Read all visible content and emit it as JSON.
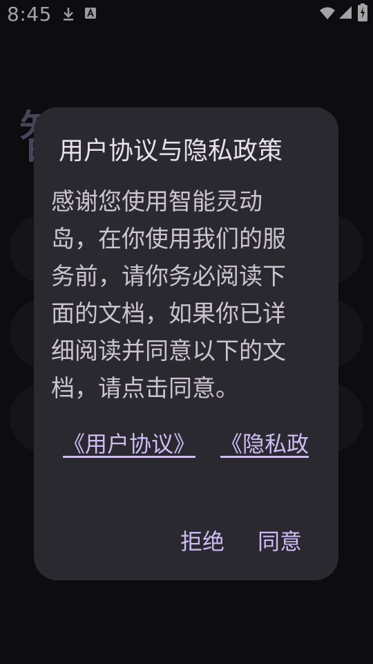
{
  "status_bar": {
    "time": "8:45",
    "icons": [
      "download-icon",
      "text-a-icon",
      "wifi-icon",
      "signal-icon",
      "battery-charging-icon"
    ]
  },
  "background": {
    "title_fragment": "智能灵动",
    "card_glyphs": [
      "·",
      "·",
      "·"
    ]
  },
  "dialog": {
    "title": "用户协议与隐私政策",
    "body": "感谢您使用智能灵动岛，在你使用我们的服务前，请你务必阅读下面的文档，如果你已详细阅读并同意以下的文档，请点击同意。",
    "links": {
      "user_agreement": "《用户协议》",
      "privacy_policy": "《隐私政"
    },
    "buttons": {
      "reject": "拒绝",
      "agree": "同意"
    }
  },
  "colors": {
    "background": "#141316",
    "dialog_surface": "#2b2930",
    "accent": "#cdbdf6",
    "body_text": "#cbc4d1",
    "title_text": "#e8e2ec"
  }
}
